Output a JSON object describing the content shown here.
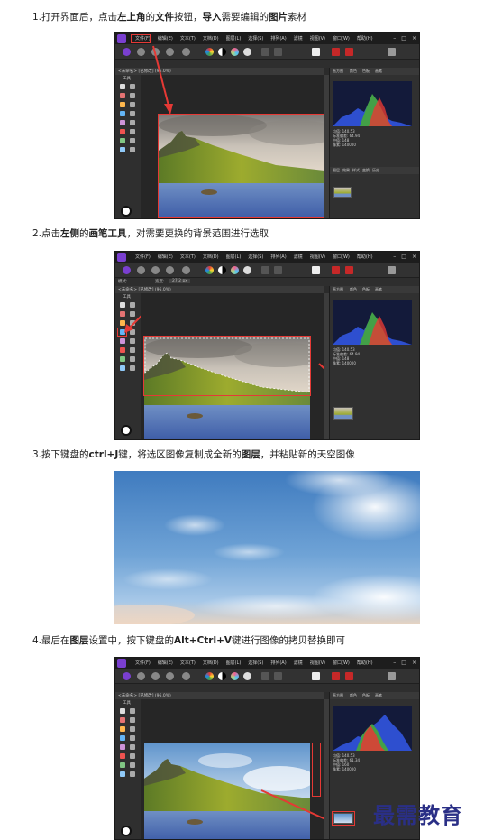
{
  "steps": [
    {
      "caption_parts": [
        "1.打开界面后，点击",
        "左上角",
        "的",
        "文件",
        "按钮，",
        "导入",
        "需要编辑的",
        "图片",
        "素材"
      ],
      "menu": [
        "文件(F)",
        "编辑(E)",
        "文本(T)",
        "文档(D)",
        "图层(L)",
        "选择(S)",
        "排列(A)",
        "滤镜",
        "视图(V)",
        "窗口(W)",
        "帮助(H)"
      ],
      "doc_tab": "<未命名> [已修改] (96.0%)",
      "tools_label": "工具",
      "histogram_stats": [
        "均值: 140.53",
        "标准偏差: 64.94",
        "中值: 148",
        "像素: 140000"
      ],
      "panel_tabs": [
        "直方图",
        "颜色",
        "色板",
        "画笔"
      ],
      "layer_tabs": [
        "图层",
        "效果",
        "样式",
        "变换",
        "历史"
      ]
    },
    {
      "caption_parts": [
        "2.点击",
        "左侧",
        "的",
        "画笔工具",
        "，对需要更换的背景范围进行选取"
      ],
      "menu": [
        "文件(F)",
        "编辑(E)",
        "文本(T)",
        "文档(D)",
        "图层(L)",
        "选择(S)",
        "排列(A)",
        "滤镜",
        "视图(V)",
        "窗口(W)",
        "帮助(H)"
      ],
      "context": [
        "模式:",
        "宽度:",
        "27.2 px"
      ],
      "doc_tab": "<未命名> [已修改] (96.0%)",
      "tools_label": "工具",
      "histogram_stats": [
        "均值: 140.53",
        "标准偏差: 64.94",
        "中值: 148",
        "像素: 140000"
      ],
      "panel_tabs": [
        "直方图",
        "颜色",
        "色板",
        "画笔"
      ]
    },
    {
      "caption_parts": [
        "3.按下键盘的",
        "ctrl+J",
        "键，将选区图像复制成全新的",
        "图层",
        "，并粘贴新的天空图像"
      ]
    },
    {
      "caption_parts": [
        "4.最后在",
        "图层",
        "设置中，按下键盘的",
        "Alt+Ctrl+V",
        "键进行图像的拷贝替换即可"
      ],
      "menu": [
        "文件(F)",
        "编辑(E)",
        "文本(T)",
        "文档(D)",
        "图层(L)",
        "选择(S)",
        "排列(A)",
        "滤镜",
        "视图(V)",
        "窗口(W)",
        "帮助(H)"
      ],
      "doc_tab": "<未命名> [已修改] (96.0%)",
      "tools_label": "工具",
      "histogram_stats": [
        "均值: 140.53",
        "标准偏差: 61.34",
        "中值: 160",
        "像素: 140000"
      ],
      "panel_tabs": [
        "直方图",
        "颜色",
        "色板",
        "画笔"
      ]
    }
  ],
  "brand_watermark": "最需教育",
  "colors": {
    "highlight_red": "#e53935",
    "app_dark": "#2b2b2b",
    "brand_blue": "#2a2f86"
  }
}
